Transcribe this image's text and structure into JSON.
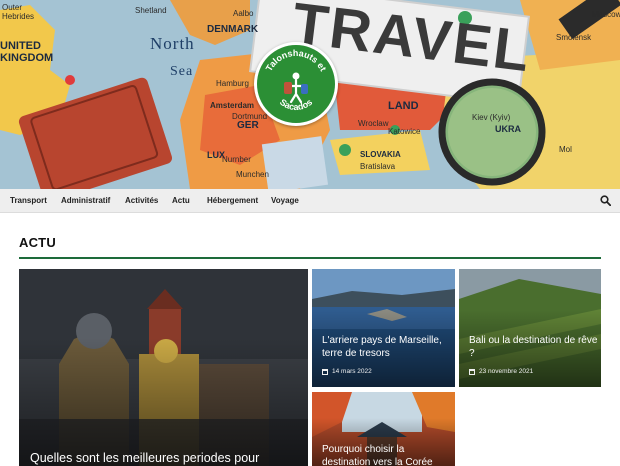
{
  "banner": {
    "logo_line1": "Talonshauts et",
    "logo_line2": "Sacados",
    "map_labels": {
      "outer_hebrides": "Outer\nHebrides",
      "shetland": "Shetland",
      "denmark": "DENMARK",
      "aalborg": "Aalbo",
      "north_sea_1": "North",
      "north_sea_2": "Sea",
      "united_kingdom": "UNITED\nKINGDOM",
      "hamburg": "Hamburg",
      "amsterdam": "Amsterdam",
      "dortmund": "Dortmund",
      "germany": "GER",
      "lux": "LUX",
      "nurnberg": "Nurnber",
      "muchen": "Munchen",
      "poland": "LAND",
      "wroclaw": "Wroclaw",
      "katowice": "Katowice",
      "slovakia": "SLOVAKIA",
      "bratislava": "Bratislava",
      "kiev": "Kiev (Kyiv)",
      "ukraine": "UKRA",
      "moldova": "Mol",
      "smolensk": "Smolensk",
      "moscow": "Moscow",
      "travel": "TRAVEL"
    }
  },
  "nav": {
    "items": [
      "Transport",
      "Administratif",
      "Activités",
      "Actu",
      "Hébergement",
      "Voyage"
    ],
    "search_icon": "search-icon"
  },
  "section": {
    "title": "ACTU"
  },
  "articles": [
    {
      "title": "Quelles sont les meilleures periodes pour",
      "date": ""
    },
    {
      "title": "L'arriere pays de Marseille, terre de tresors",
      "date": "14 mars 2022"
    },
    {
      "title": "Bali ou la destination de rêve ?",
      "date": "23 novembre 2021"
    },
    {
      "title": "Pourquoi choisir la destination vers la Corée",
      "date": ""
    }
  ],
  "colors": {
    "accent_green": "#1d6b3a",
    "logo_green": "#2b8f35",
    "nav_bg": "#eeeeee"
  }
}
